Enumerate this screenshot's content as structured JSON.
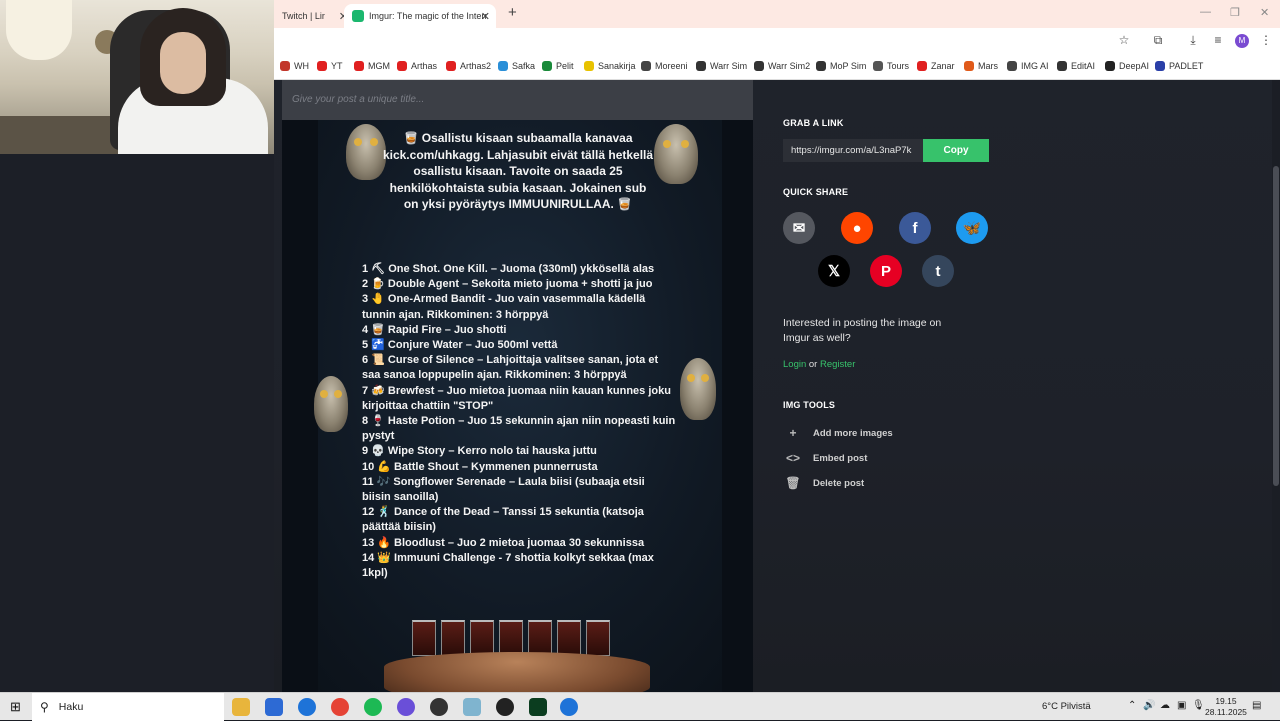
{
  "browser": {
    "tabs": [
      {
        "label": "Twitch | Lir"
      },
      {
        "label": "Imgur: The magic of the Interne"
      }
    ],
    "new_tab": "+",
    "bookmarks": [
      {
        "label": "WH",
        "color": "#c2362b"
      },
      {
        "label": "YT",
        "color": "#e02020"
      },
      {
        "label": "MGM",
        "color": "#e02020"
      },
      {
        "label": "Arthas",
        "color": "#e02020"
      },
      {
        "label": "Arthas2",
        "color": "#e02020"
      },
      {
        "label": "Safka",
        "color": "#2a8fd8"
      },
      {
        "label": "Pelit",
        "color": "#1a8a3a"
      },
      {
        "label": "Sanakirja",
        "color": "#e8c200"
      },
      {
        "label": "Moreeni",
        "color": "#444444"
      },
      {
        "label": "Warr Sim",
        "color": "#333333"
      },
      {
        "label": "Warr Sim2",
        "color": "#333333"
      },
      {
        "label": "MoP Sim",
        "color": "#333333"
      },
      {
        "label": "Tours",
        "color": "#555555"
      },
      {
        "label": "Zanar",
        "color": "#e02020"
      },
      {
        "label": "Mars",
        "color": "#e05a1a"
      },
      {
        "label": "IMG AI",
        "color": "#444444"
      },
      {
        "label": "EditAI",
        "color": "#333333"
      },
      {
        "label": "DeepAI",
        "color": "#222222"
      },
      {
        "label": "PADLET",
        "color": "#2a3fa8"
      }
    ],
    "profile_initial": "M"
  },
  "post": {
    "title_placeholder": "Give your post a unique title...",
    "intro": "🥃 Osallistu kisaan subaamalla kanavaa kick.com/uhkagg. Lahjasubit eivät tällä hetkellä osallistu kisaan. Tavoite on saada 25 henkilökohtaista subia kasaan. Jokainen sub on yksi pyöräytys IMMUUNIRULLAA. 🥃",
    "rules": [
      "1 ⛏ One Shot. One Kill. – Juoma (330ml) ykkösellä alas",
      "2 🍺 Double Agent – Sekoita mieto juoma + shotti ja juo",
      "3 🤚 One-Armed Bandit - Juo vain vasemmalla kädellä tunnin ajan. Rikkominen: 3 hörppyä",
      "4 🥃 Rapid Fire – Juo shotti",
      "5 🚰 Conjure Water – Juo 500ml vettä",
      "6 📜 Curse of Silence – Lahjoittaja valitsee sanan, jota et saa sanoa loppupelin ajan. Rikkominen: 3 hörppyä",
      "7 🍻 Brewfest – Juo mietoa juomaa niin kauan kunnes joku kirjoittaa chattiin \"STOP\"",
      "8 🍷 Haste Potion – Juo 15 sekunnin ajan niin nopeasti kuin pystyt",
      "9 💀 Wipe Story – Kerro nolo tai hauska juttu",
      "10 💪 Battle Shout – Kymmenen punnerrusta",
      "11 🎶 Songflower Serenade – Laula biisi (subaaja etsii biisin sanoilla)",
      "12 🕺 Dance of the Dead – Tanssi 15 sekuntia (katsoja päättää biisin)",
      "13 🔥 Bloodlust – Juo 2 mietoa juomaa 30 sekunnissa",
      "14 👑 Immuuni Challenge - 7 shottia kolkyt sekkaa (max 1kpl)"
    ]
  },
  "sidebar": {
    "grab_link_title": "GRAB A LINK",
    "link_value": "https://imgur.com/a/L3naP7k",
    "copy_label": "Copy",
    "quick_share_title": "QUICK SHARE",
    "share": [
      {
        "name": "email",
        "glyph": "✉",
        "color": "#55585f"
      },
      {
        "name": "reddit",
        "glyph": "●",
        "color": "#ff4500"
      },
      {
        "name": "facebook",
        "glyph": "f",
        "color": "#3b5998"
      },
      {
        "name": "bluesky",
        "glyph": "🦋",
        "color": "#1d9bf0"
      },
      {
        "name": "x",
        "glyph": "𝕏",
        "color": "#000000"
      },
      {
        "name": "pinterest",
        "glyph": "P",
        "color": "#e60023"
      },
      {
        "name": "tumblr",
        "glyph": "t",
        "color": "#35465c"
      }
    ],
    "interested_text": "Interested in posting the image on Imgur as well?",
    "login_label": "Login",
    "or_label": "or",
    "register_label": "Register",
    "img_tools_title": "IMG TOOLS",
    "tools": [
      {
        "label": "Add more images",
        "icon": "+"
      },
      {
        "label": "Embed post",
        "icon": "<>"
      },
      {
        "label": "Delete post",
        "icon": "🗑"
      }
    ]
  },
  "taskbar": {
    "search_label": "Haku",
    "weather": "6°C Pilvistä",
    "time": "19.15",
    "date": "28.11.2025"
  }
}
